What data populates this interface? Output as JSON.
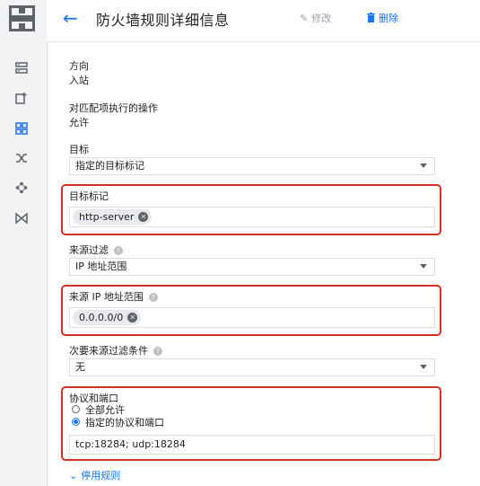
{
  "header": {
    "title": "防火墙规则详细信息",
    "edit_label": "修改",
    "delete_label": "删除"
  },
  "sidebar": {
    "icons": [
      "list-icon",
      "add-icon",
      "grid-icon",
      "shuffle-icon",
      "nodes-icon",
      "bowtie-icon"
    ],
    "active_index": 2
  },
  "details": {
    "direction_label": "方向",
    "direction_value": "入站",
    "action_label": "对匹配项执行的操作",
    "action_value": "允许",
    "target_label": "目标",
    "target_value": "指定的目标标记",
    "target_tags_label": "目标标记",
    "target_tag_chip": "http-server",
    "source_filter_label": "来源过滤",
    "source_filter_value": "IP 地址范围",
    "source_ip_label": "来源 IP 地址范围",
    "source_ip_chip": "0.0.0.0/0",
    "secondary_filter_label": "次要来源过滤条件",
    "secondary_filter_value": "无",
    "protocols_label": "协议和端口",
    "radio_allow_all": "全部允许",
    "radio_specified": "指定的协议和端口",
    "protocols_value": "tcp:18284; udp:18284",
    "disable_rule_link": "停用规则"
  },
  "colors": {
    "accent": "#1a73e8",
    "highlight_box": "#d93025"
  }
}
